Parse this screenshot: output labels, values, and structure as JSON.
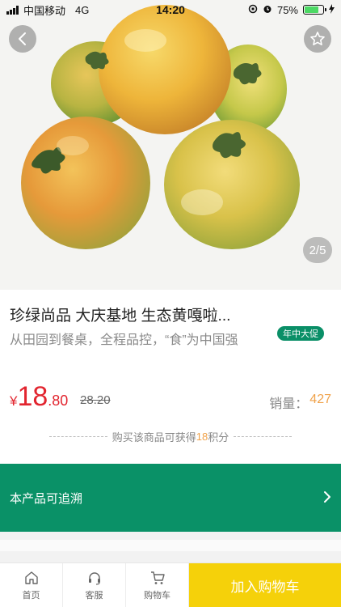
{
  "status_bar": {
    "carrier": "中国移动",
    "network": "4G",
    "time": "14:20",
    "battery": "75%",
    "battery_level": 0.75
  },
  "gallery": {
    "pager": "2/5",
    "image_alt": "tomatoes-photo"
  },
  "product": {
    "title": "珍绿尚品 大庆基地 生态黄嘎啦...",
    "subtitle": "从田园到餐桌，全程品控，“食”为中国强",
    "promo_badge": "年中大促",
    "price": {
      "currency": "¥",
      "integer": "18",
      "decimal": ".80"
    },
    "original_price": "28.20",
    "sales_label": "销量：",
    "sales_count": "427"
  },
  "points": {
    "prefix": "购买该商品可获得",
    "value": "18",
    "suffix": "积分"
  },
  "trace": {
    "label": "本产品可追溯"
  },
  "bottom_nav": {
    "tabs": [
      {
        "label": "首页",
        "icon": "home-icon"
      },
      {
        "label": "客服",
        "icon": "headset-icon"
      },
      {
        "label": "购物车",
        "icon": "cart-icon"
      }
    ],
    "add_to_cart": "加入购物车"
  },
  "colors": {
    "accent_green": "#0a9167",
    "price_red": "#e2252f",
    "highlight_orange": "#f0a24a",
    "cart_yellow": "#f5d10a"
  }
}
